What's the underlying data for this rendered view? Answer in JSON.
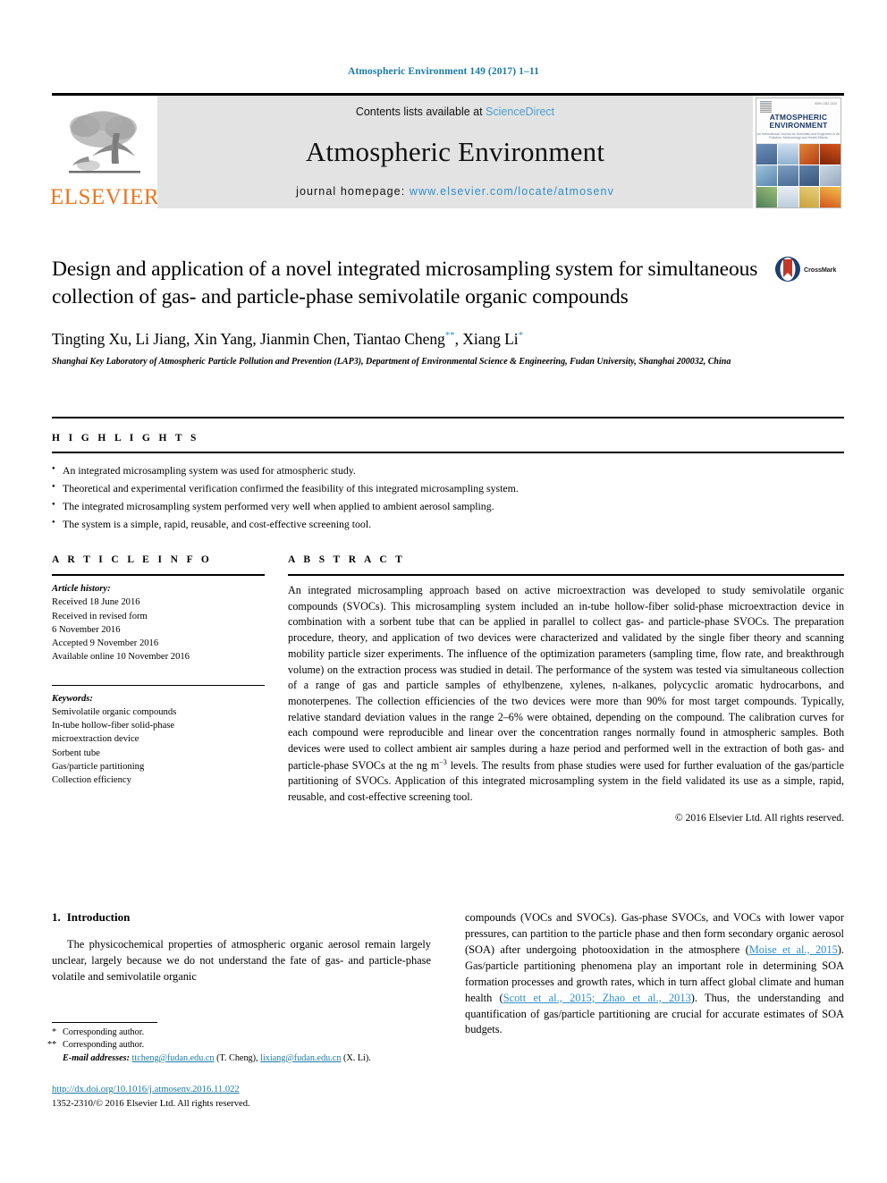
{
  "running_head": "Atmospheric Environment 149 (2017) 1–11",
  "masthead": {
    "publisher": "ELSEVIER",
    "contents_prefix": "Contents lists available at ",
    "contents_link": "ScienceDirect",
    "journal_name": "Atmospheric Environment",
    "homepage_prefix": "journal homepage: ",
    "homepage_url": "www.elsevier.com/locate/atmosenv",
    "cover": {
      "title_line1": "ATMOSPHERIC",
      "title_line2": "ENVIRONMENT",
      "subtitle": "An International Journal for Scientists and Engineers in Air Pollution, Meteorology and Health Effects",
      "issn": "ISSN 1352-2310"
    },
    "colors": {
      "link": "#4a9fd4",
      "elsevier_orange": "#E87722",
      "banner_bg": "#e3e3e3"
    }
  },
  "article": {
    "title": "Design and application of a novel integrated microsampling system for simultaneous collection of gas- and particle-phase semivolatile organic compounds",
    "authors": "Tingting Xu, Li Jiang, Xin Yang, Jianmin Chen, Tiantao Cheng",
    "authors_tail": ", Xiang Li",
    "corresponding_mark_1": "**",
    "corresponding_mark_2": "*",
    "affiliation": "Shanghai Key Laboratory of Atmospheric Particle Pollution and Prevention (LAP3), Department of Environmental Science & Engineering, Fudan University, Shanghai 200032, China",
    "crossmark_label": "CrossMark"
  },
  "highlights": {
    "heading": "H I G H L I G H T S",
    "items": [
      "An integrated microsampling system was used for atmospheric study.",
      "Theoretical and experimental verification confirmed the feasibility of this integrated microsampling system.",
      "The integrated microsampling system performed very well when applied to ambient aerosol sampling.",
      "The system is a simple, rapid, reusable, and cost-effective screening tool."
    ]
  },
  "article_info": {
    "heading": "A R T I C L E  I N F O",
    "history_label": "Article history:",
    "history": [
      "Received 18 June 2016",
      "Received in revised form",
      "6 November 2016",
      "Accepted 9 November 2016",
      "Available online 10 November 2016"
    ],
    "keywords_label": "Keywords:",
    "keywords": [
      "Semivolatile organic compounds",
      "In-tube hollow-fiber solid-phase",
      "microextraction device",
      "Sorbent tube",
      "Gas/particle partitioning",
      "Collection efficiency"
    ]
  },
  "abstract": {
    "heading": "A B S T R A C T",
    "text_part1": "An integrated microsampling approach based on active microextraction was developed to study semivolatile organic compounds (SVOCs). This microsampling system included an in-tube hollow-fiber solid-phase microextraction device in combination with a sorbent tube that can be applied in parallel to collect gas- and particle-phase SVOCs. The preparation procedure, theory, and application of two devices were characterized and validated by the single fiber theory and scanning mobility particle sizer experiments. The influence of the optimization parameters (sampling time, flow rate, and breakthrough volume) on the extraction process was studied in detail. The performance of the system was tested via simultaneous collection of a range of gas and particle samples of ethylbenzene, xylenes, n-alkanes, polycyclic aromatic hydrocarbons, and monoterpenes. The collection efficiencies of the two devices were more than 90% for most target compounds. Typically, relative standard deviation values in the range 2–6% were obtained, depending on the compound. The calibration curves for each compound were reproducible and linear over the concentration ranges normally found in atmospheric samples. Both devices were used to collect ambient air samples during a haze period and performed well in the extraction of both gas- and particle-phase SVOCs at the ng m",
    "superscript": "−3",
    "text_part2": " levels. The results from phase studies were used for further evaluation of the gas/particle partitioning of SVOCs. Application of this integrated microsampling system in the field validated its use as a simple, rapid, reusable, and cost-effective screening tool.",
    "copyright": "© 2016 Elsevier Ltd. All rights reserved."
  },
  "introduction": {
    "number": "1.",
    "title": "Introduction",
    "left_paragraph": "The physicochemical properties of atmospheric organic aerosol remain largely unclear, largely because we do not understand the fate of gas- and particle-phase volatile and semivolatile organic",
    "right_part1": "compounds (VOCs and SVOCs). Gas-phase SVOCs, and VOCs with lower vapor pressures, can partition to the particle phase and then form secondary organic aerosol (SOA) after undergoing photooxidation in the atmosphere (",
    "citation1": "Moise et al., 2015",
    "right_part2": "). Gas/particle partitioning phenomena play an important role in determining SOA formation processes and growth rates, which in turn affect global climate and human health (",
    "citation2": "Scott et al., 2015; Zhao et al., 2013",
    "right_part3": "). Thus, the understanding and quantification of gas/particle partitioning are crucial for accurate estimates of SOA budgets."
  },
  "footnotes": {
    "corresponding_1_mark": "*",
    "corresponding_1": "Corresponding author.",
    "corresponding_2_mark": "**",
    "corresponding_2": "Corresponding author.",
    "email_label": "E-mail addresses:",
    "email_1": "ttcheng@fudan.edu.cn",
    "email_1_name": "(T. Cheng)",
    "email_2": "lixiang@fudan.edu.cn",
    "email_2_name": "(X. Li)."
  },
  "footer": {
    "doi": "http://dx.doi.org/10.1016/j.atmosenv.2016.11.022",
    "issn_line": "1352-2310/© 2016 Elsevier Ltd. All rights reserved."
  }
}
